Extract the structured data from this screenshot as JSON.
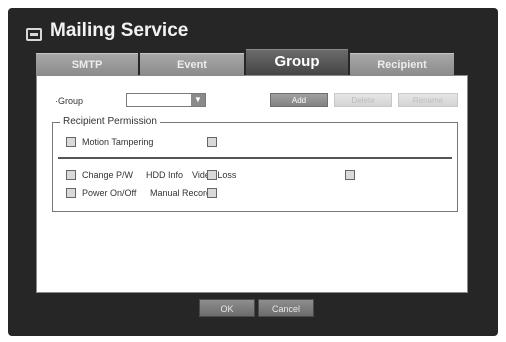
{
  "window": {
    "title": "Mailing Service",
    "icon": "mail-window-icon"
  },
  "tabs": [
    {
      "label": "SMTP",
      "active": false
    },
    {
      "label": "Event",
      "active": false
    },
    {
      "label": "Group",
      "active": true
    },
    {
      "label": "Recipient",
      "active": false
    }
  ],
  "group": {
    "label": "Group",
    "selected_value": "",
    "add_label": "Add",
    "delete_label": "Delete",
    "rename_label": "Rename"
  },
  "permission": {
    "legend": "Recipient Permission",
    "row1": {
      "label": "Motion",
      "label2": "Tampering"
    },
    "row2": {
      "label": "Change P/W",
      "label2": "HDD Info",
      "label3": "Video Loss"
    },
    "row3": {
      "label": "Power On/Off",
      "label2": "Manual Record"
    }
  },
  "footer": {
    "ok_label": "OK",
    "cancel_label": "Cancel"
  },
  "colors": {
    "frame": "#262626",
    "active_tab": "#454545",
    "inactive_tab": "#9a9a9a",
    "panel": "#ffffff"
  }
}
